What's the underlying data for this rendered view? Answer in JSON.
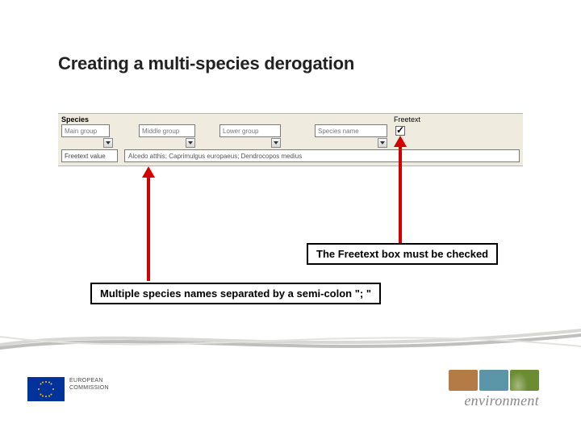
{
  "title": "Creating a multi-species derogation",
  "species": {
    "section_label": "Species",
    "main_group": {
      "label": "Main group",
      "value": ""
    },
    "middle_group": {
      "label": "Middle group",
      "value": ""
    },
    "lower_group": {
      "label": "Lower group",
      "value": ""
    },
    "species_name": {
      "label": "Species name",
      "value": ""
    },
    "freetext": {
      "label": "Freetext",
      "checked": true
    },
    "freetext_value": {
      "label": "Freetext value",
      "value": "Alcedo atthis; Caprimulgus europaeus; Dendrocopos medius"
    }
  },
  "callouts": {
    "top": "The Freetext box must be checked",
    "bottom": "Multiple species names separated by a semi-colon \"; \""
  },
  "footer": {
    "ec_line1": "EUROPEAN",
    "ec_line2": "COMMISSION",
    "env": "environment"
  }
}
